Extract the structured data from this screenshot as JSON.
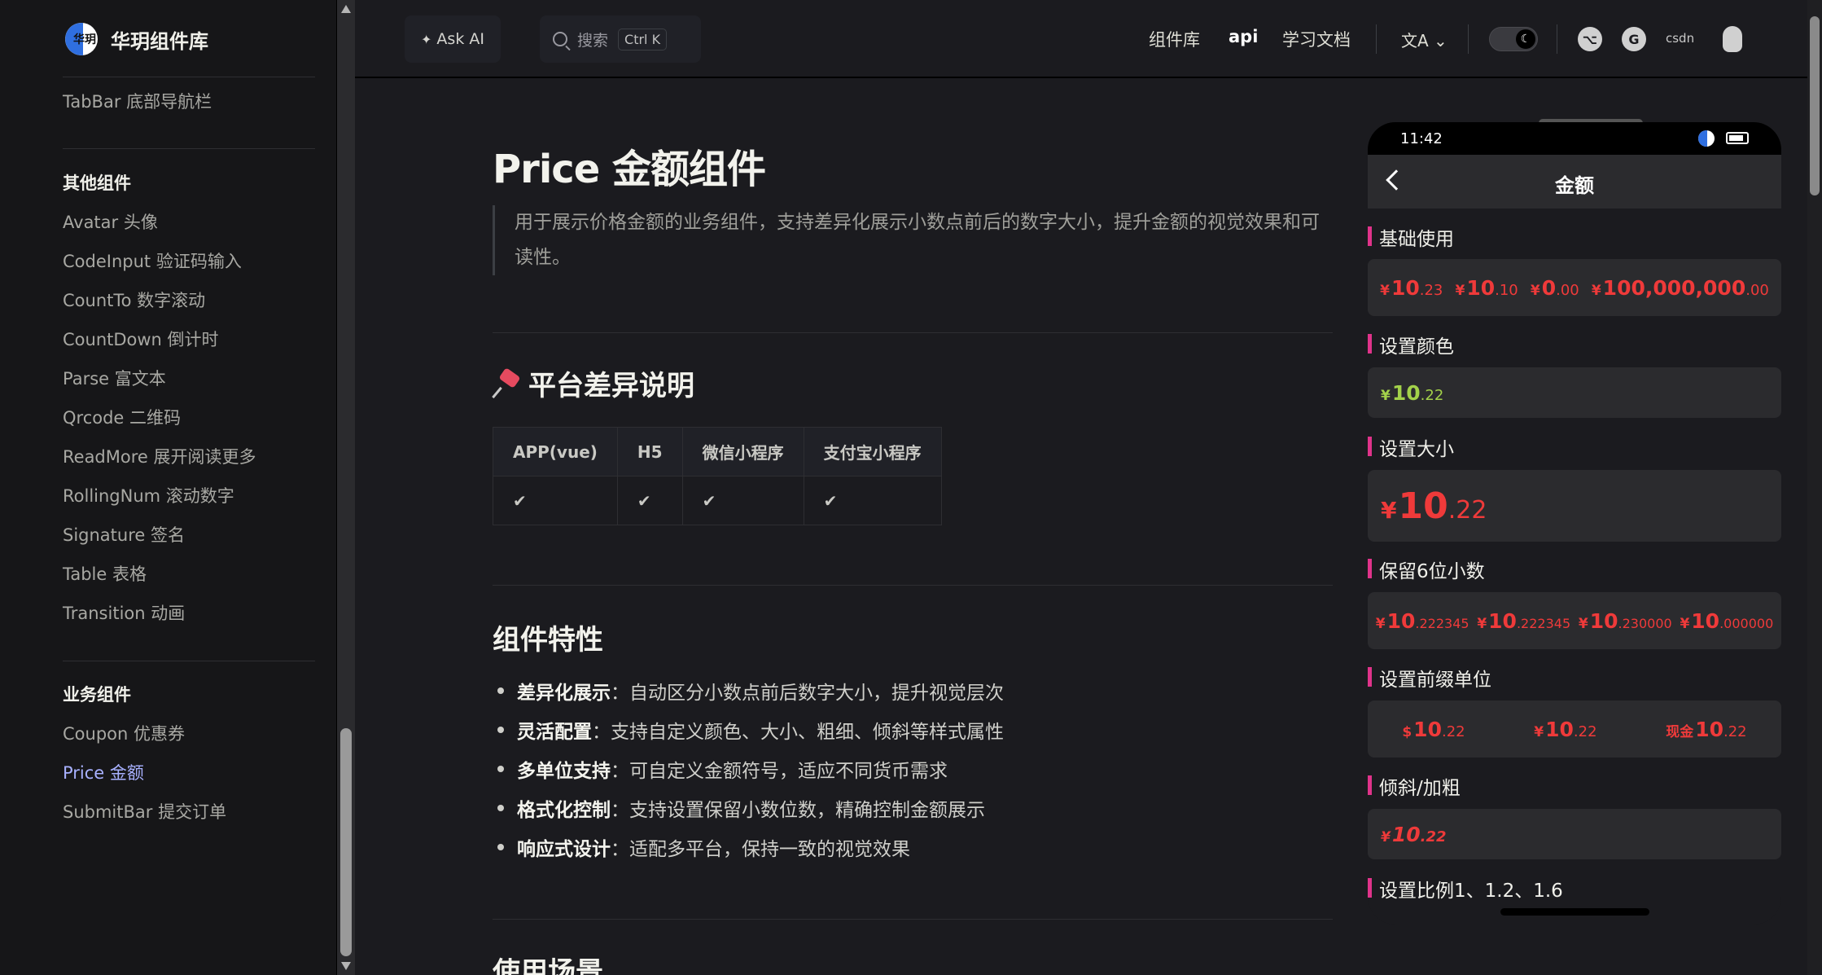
{
  "sidebar": {
    "brand": "华玥组件库",
    "logo_text": "华玥",
    "top_item": "TabBar 底部导航栏",
    "groups": [
      {
        "title": "其他组件",
        "items": [
          "Avatar 头像",
          "CodeInput 验证码输入",
          "CountTo 数字滚动",
          "CountDown 倒计时",
          "Parse 富文本",
          "Qrcode 二维码",
          "ReadMore 展开阅读更多",
          "RollingNum 滚动数字",
          "Signature 签名",
          "Table 表格",
          "Transition 动画"
        ]
      },
      {
        "title": "业务组件",
        "items": [
          "Coupon 优惠券",
          "Price 金额",
          "SubmitBar 提交订单"
        ]
      }
    ],
    "active_item": "Price 金额"
  },
  "navbar": {
    "ask_ai": "Ask AI",
    "search_placeholder": "搜索",
    "search_kbd": "Ctrl K",
    "links": [
      "组件库",
      "api",
      "学习文档"
    ],
    "lang_icon": "translate-icon",
    "csdn": "csdn",
    "theme": "dark"
  },
  "article": {
    "title": "Price 金额组件",
    "intro": "用于展示价格金额的业务组件，支持差异化展示小数点前后的数字大小，提升金额的视觉效果和可读性。",
    "platform_heading": "平台差异说明",
    "platform_table": {
      "headers": [
        "APP(vue)",
        "H5",
        "微信小程序",
        "支付宝小程序"
      ],
      "row": [
        "✔",
        "✔",
        "✔",
        "✔"
      ]
    },
    "features_heading": "组件特性",
    "features": [
      {
        "label": "差异化展示",
        "text": "：自动区分小数点前后数字大小，提升视觉层次"
      },
      {
        "label": "灵活配置",
        "text": "：支持自定义颜色、大小、粗细、倾斜等样式属性"
      },
      {
        "label": "多单位支持",
        "text": "：可自定义金额符号，适应不同货币需求"
      },
      {
        "label": "格式化控制",
        "text": "：支持设置保留小数位数，精确控制金额展示"
      },
      {
        "label": "响应式设计",
        "text": "：适配多平台，保持一致的视觉效果"
      }
    ],
    "next_heading": "使用场景"
  },
  "phone": {
    "time": "11:42",
    "title": "金额",
    "sections": [
      {
        "title": "基础使用",
        "prices": [
          {
            "sym": "¥",
            "int": "10",
            "dec": ".23"
          },
          {
            "sym": "¥",
            "int": "10",
            "dec": ".10"
          },
          {
            "sym": "¥",
            "int": "0",
            "dec": ".00"
          },
          {
            "sym": "¥",
            "int": "100,000,000",
            "dec": ".00"
          }
        ]
      },
      {
        "title": "设置颜色",
        "prices": [
          {
            "sym": "¥",
            "int": "10",
            "dec": ".22",
            "color": "#a3d14a"
          }
        ]
      },
      {
        "title": "设置大小",
        "prices": [
          {
            "sym": "¥",
            "int": "10",
            "dec": ".22"
          }
        ]
      },
      {
        "title": "保留6位小数",
        "prices": [
          {
            "sym": "¥",
            "int": "10",
            "dec": ".222345"
          },
          {
            "sym": "¥",
            "int": "10",
            "dec": ".222345"
          },
          {
            "sym": "¥",
            "int": "10",
            "dec": ".230000"
          },
          {
            "sym": "¥",
            "int": "10",
            "dec": ".000000"
          }
        ]
      },
      {
        "title": "设置前缀单位",
        "prices": [
          {
            "sym": "$",
            "int": "10",
            "dec": ".22"
          },
          {
            "sym": "¥",
            "int": "10",
            "dec": ".22"
          },
          {
            "sym": "现金",
            "int": "10",
            "dec": ".22"
          }
        ]
      },
      {
        "title": "倾斜/加粗",
        "prices": [
          {
            "sym": "¥",
            "int": "10",
            "dec": ".22"
          }
        ]
      },
      {
        "title": "设置比例1、1.2、1.6",
        "prices": []
      }
    ],
    "price_color": "#ef3a3a",
    "accent": "#e0338a"
  }
}
